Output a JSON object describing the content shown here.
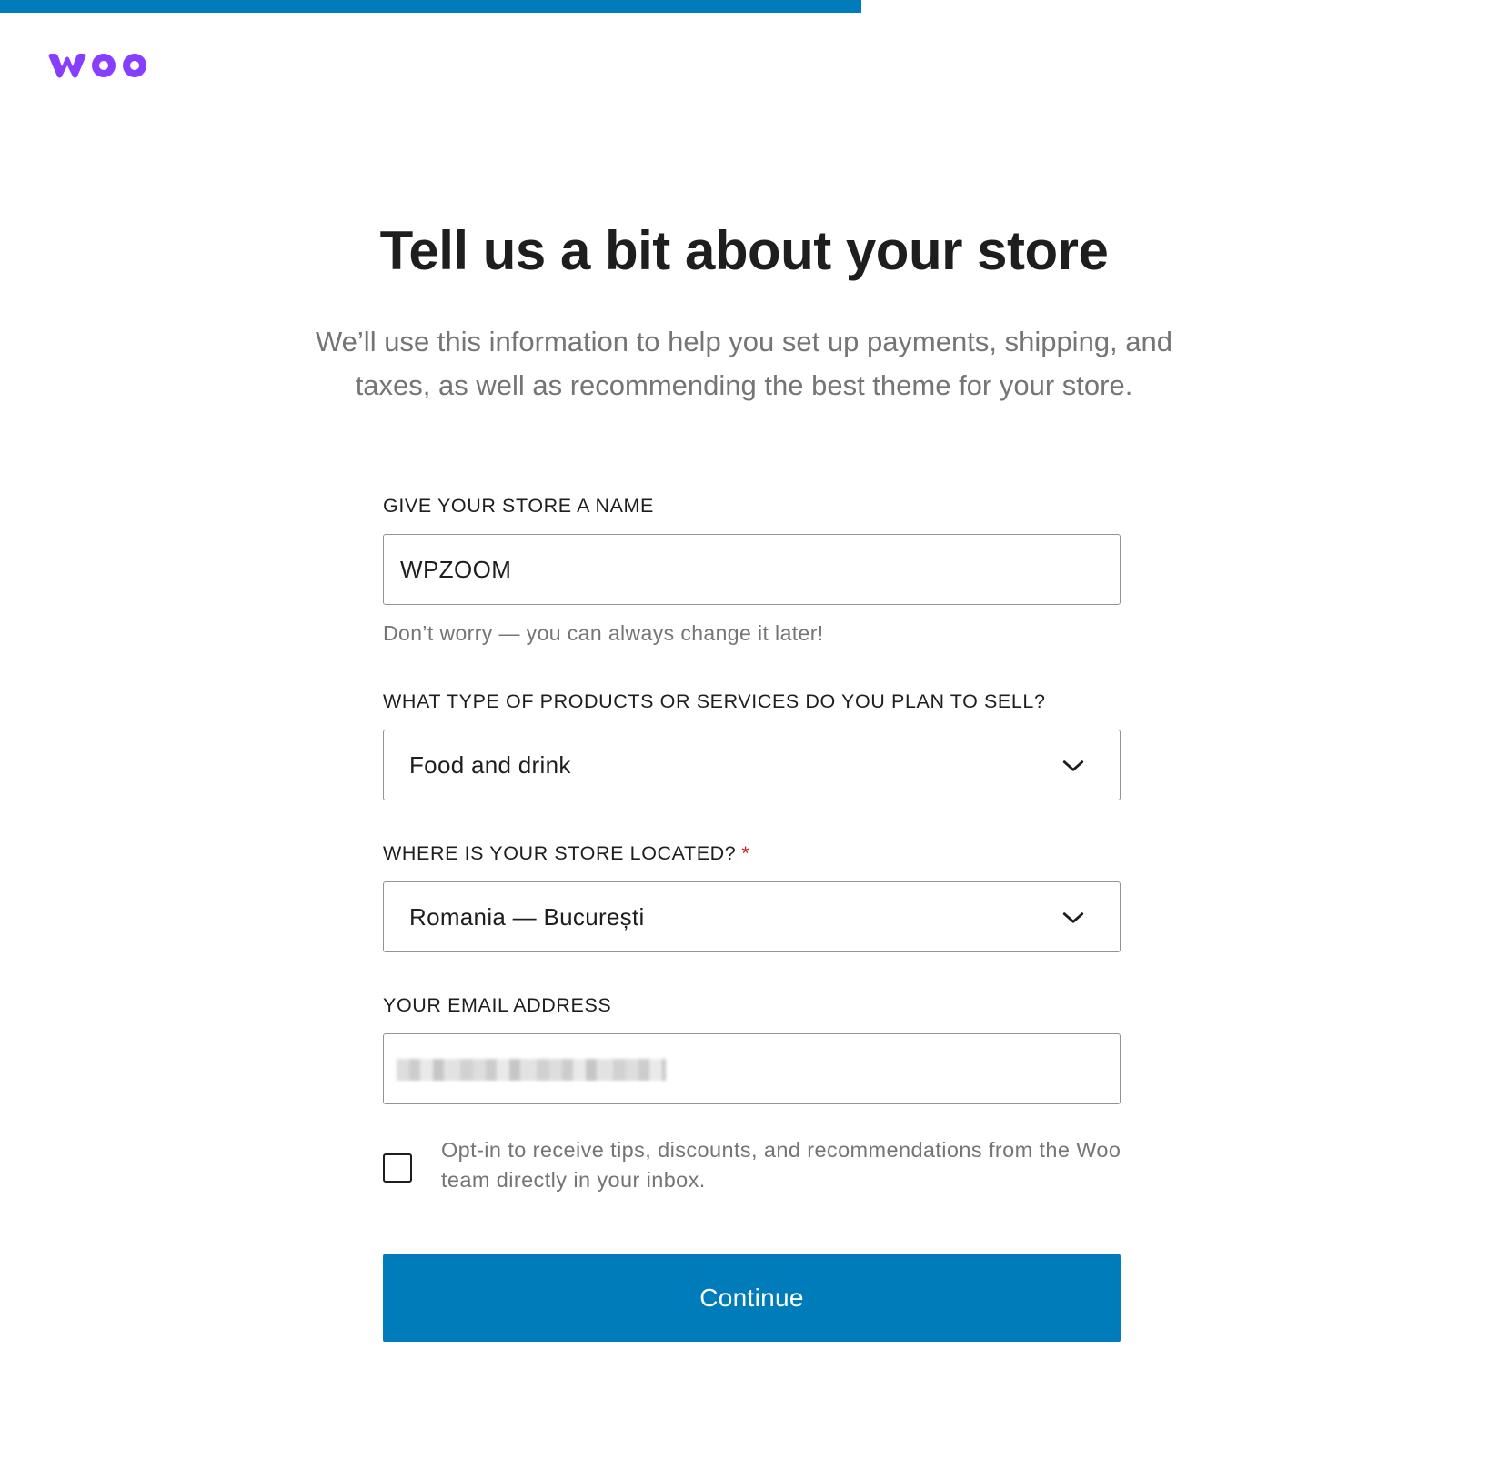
{
  "progress": {
    "fraction": 0.579,
    "color": "#007cba"
  },
  "brand": {
    "name": "woo",
    "color": "#7f54b3"
  },
  "header": {
    "title": "Tell us a bit about your store",
    "subtitle": "We’ll use this information to help you set up payments, shipping, and taxes, as well as recommending the best theme for your store."
  },
  "form": {
    "store_name": {
      "label": "GIVE YOUR STORE A NAME",
      "value": "WPZOOM",
      "help": "Don’t worry — you can always change it later!"
    },
    "products": {
      "label": "WHAT TYPE OF PRODUCTS OR SERVICES DO YOU PLAN TO SELL?",
      "value": "Food and drink",
      "icon": "chevron-down-icon"
    },
    "location": {
      "label": "WHERE IS YOUR STORE LOCATED?",
      "required_mark": "*",
      "value": "Romania — București",
      "icon": "chevron-down-icon"
    },
    "email": {
      "label": "YOUR EMAIL ADDRESS",
      "value_obscured": true
    },
    "optin": {
      "checked": false,
      "text": "Opt-in to receive tips, discounts, and recommendations from the Woo team directly in your inbox."
    },
    "submit_label": "Continue"
  },
  "colors": {
    "primary": "#007cba",
    "required": "#cc1818",
    "muted_text": "#757575"
  }
}
